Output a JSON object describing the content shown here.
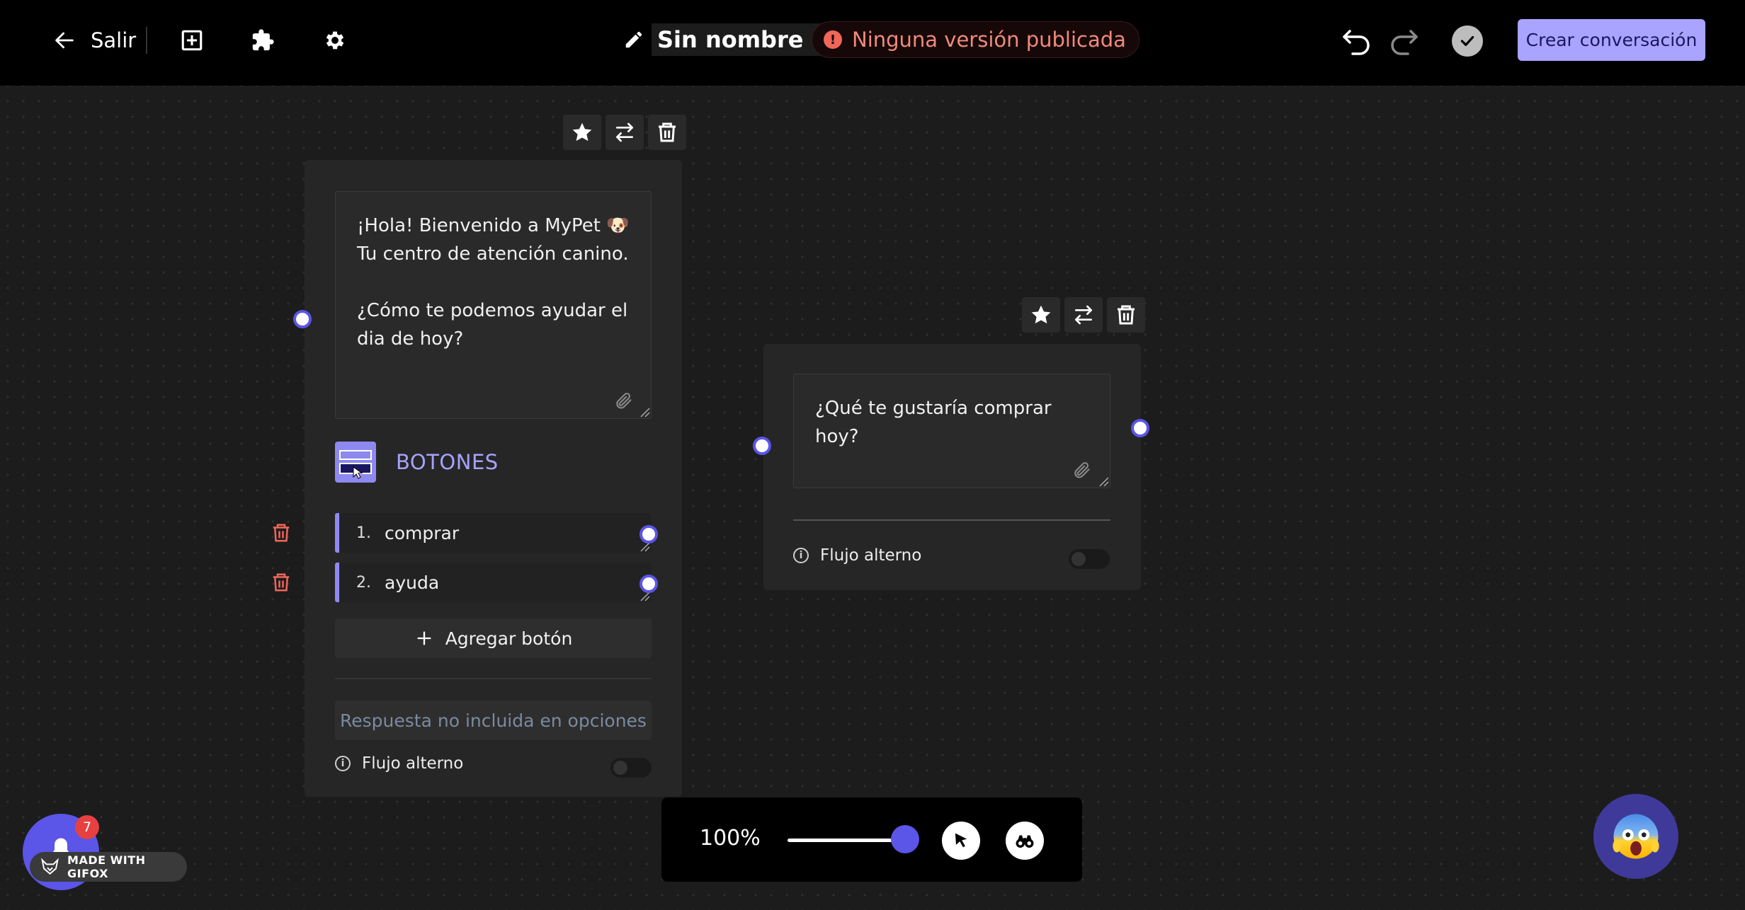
{
  "header": {
    "exit_label": "Salir",
    "title": "Sin nombre",
    "status_badge": "Ninguna versión publicada",
    "create_button": "Crear conversación"
  },
  "node1": {
    "message": "¡Hola! Bienvenido a MyPet 🐶 Tu centro de atención canino.\n\n¿Cómo te podemos ayudar el dia de hoy?",
    "section_title": "BOTONES",
    "options": [
      {
        "num": "1.",
        "label": "comprar"
      },
      {
        "num": "2.",
        "label": "ayuda"
      }
    ],
    "add_button": "Agregar botón",
    "fallback_placeholder": "Respuesta no incluida en opciones",
    "alt_flow_label": "Flujo alterno"
  },
  "node2": {
    "message": "¿Qué te gustaría comprar hoy?",
    "alt_flow_label": "Flujo alterno"
  },
  "zoom": {
    "value": "100%",
    "level": 1.0
  },
  "widgets": {
    "notification_count": "7",
    "made_with": "MADE WITH GIFOX"
  },
  "colors": {
    "accent": "#5b55e8",
    "accent_light": "#a9a4ff",
    "danger": "#f0675a",
    "background": "#1c1c1c",
    "card": "#262626"
  }
}
